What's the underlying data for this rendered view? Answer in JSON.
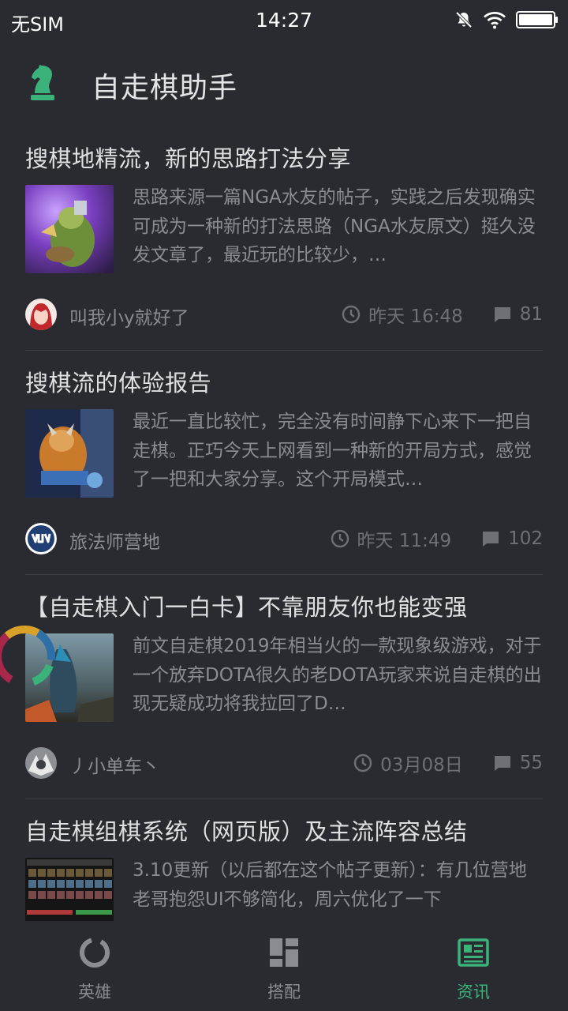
{
  "status_bar": {
    "carrier": "无SIM",
    "time": "14:27",
    "icons": [
      "bell-muted-icon",
      "wifi-icon",
      "battery-icon"
    ]
  },
  "app_bar": {
    "title": "自走棋助手",
    "logo_icon": "chess-knight-icon",
    "accent_color": "#3ab27a"
  },
  "posts": [
    {
      "title": "搜棋地精流，新的思路打法分享",
      "excerpt": "思路来源一篇NGA水友的帖子，实践之后发现确实可成为一种新的打法思路（NGA水友原文）挺久没发文章了，最近玩的比较少，…",
      "author": "叫我小y就好了",
      "time": "昨天 16:48",
      "comments": "81"
    },
    {
      "title": "搜棋流的体验报告",
      "excerpt": "最近一直比较忙，完全没有时间静下心来下一把自走棋。正巧今天上网看到一种新的开局方式，感觉了一把和大家分享。这个开局模式…",
      "author": "旅法师营地",
      "time": "昨天 11:49",
      "comments": "102"
    },
    {
      "title": "【自走棋入门一白卡】不靠朋友你也能变强",
      "excerpt": "前文自走棋2019年相当火的一款现象级游戏，对于一个放弃DOTA很久的老DOTA玩家来说自走棋的出现无疑成功将我拉回了D…",
      "author": "丿小单车丶",
      "time": "03月08日",
      "comments": "55"
    },
    {
      "title": "自走棋组棋系统（网页版）及主流阵容总结",
      "excerpt": "3.10更新（以后都在这个帖子更新）：有几位营地老哥抱怨UI不够简化，周六优化了一下",
      "author": "",
      "time": "",
      "comments": ""
    }
  ],
  "tab_bar": {
    "tabs": [
      {
        "label": "英雄",
        "icon": "hero-ring-icon",
        "active": false
      },
      {
        "label": "搭配",
        "icon": "grid-layout-icon",
        "active": false
      },
      {
        "label": "资讯",
        "icon": "newspaper-icon",
        "active": true
      }
    ]
  }
}
